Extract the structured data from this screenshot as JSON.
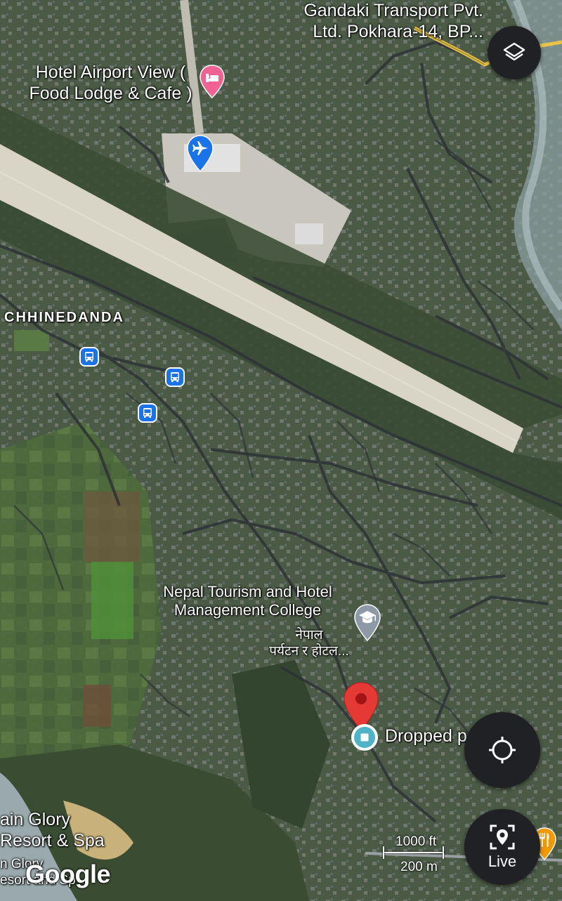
{
  "map": {
    "type": "satellite",
    "labels": {
      "transport_line1": "Gandaki Transport Pvt.",
      "transport_line2": "Ltd. Pokhara-14, BP...",
      "hotel_line1": "Hotel Airport View (",
      "hotel_line2": "Food Lodge & Cafe )",
      "area": "CHHINEDANDA",
      "college_line1": "Nepal Tourism and Hotel",
      "college_line2": "Management College",
      "college_nepali_line1": "नेपाल",
      "college_nepali_line2": "पर्यटन र होटल...",
      "dropped_pin": "Dropped p",
      "resort_line1": "ain Glory",
      "resort_line2": "Resort & Spa",
      "resort_line3": "n Glory",
      "resort_line4": "esort and Sp"
    },
    "icons": {
      "hotel": "bed-icon",
      "airport": "airplane-icon",
      "bus": "bus-icon",
      "school": "graduation-cap-icon",
      "restaurant": "fork-knife-icon",
      "pin": "map-pin-icon"
    },
    "colors": {
      "hotel_pin": "#f06292",
      "airport_pin": "#1a73e8",
      "bus_stop": "#1a73e8",
      "school_pin": "#8e99a8",
      "dropped_pin": "#e53935",
      "dropped_marker": "#4fb3c8",
      "restaurant_pin": "#f29900"
    }
  },
  "controls": {
    "layers_icon": "layers-icon",
    "location_icon": "crosshair-icon",
    "live_icon": "ar-location-icon",
    "live_label": "Live"
  },
  "scale": {
    "imperial": "1000 ft",
    "metric": "200 m"
  },
  "branding": {
    "logo": "Google"
  }
}
